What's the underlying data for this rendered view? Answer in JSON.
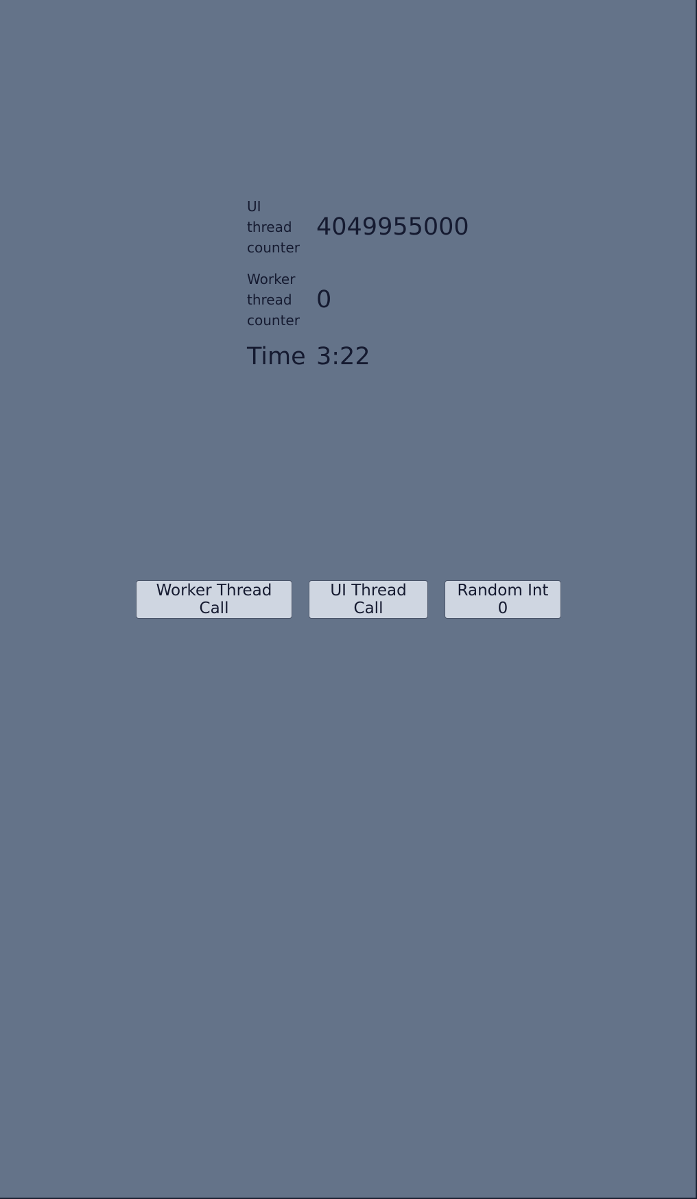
{
  "stats": {
    "ui_counter_label_lines": [
      "UI",
      "thread",
      "counter"
    ],
    "ui_counter_value": "4049955000",
    "worker_counter_label_lines": [
      "Worker",
      "thread",
      "counter"
    ],
    "worker_counter_value": "0",
    "time_label": "Time",
    "time_value": "3:22"
  },
  "buttons": {
    "worker_thread_call": "Worker Thread Call",
    "ui_thread_call": "UI Thread Call",
    "random_int": "Random Int 0"
  },
  "colors": {
    "background": "#647389",
    "text": "#151a30",
    "button_bg": "#cfd6e1",
    "button_border": "#4a5468"
  }
}
